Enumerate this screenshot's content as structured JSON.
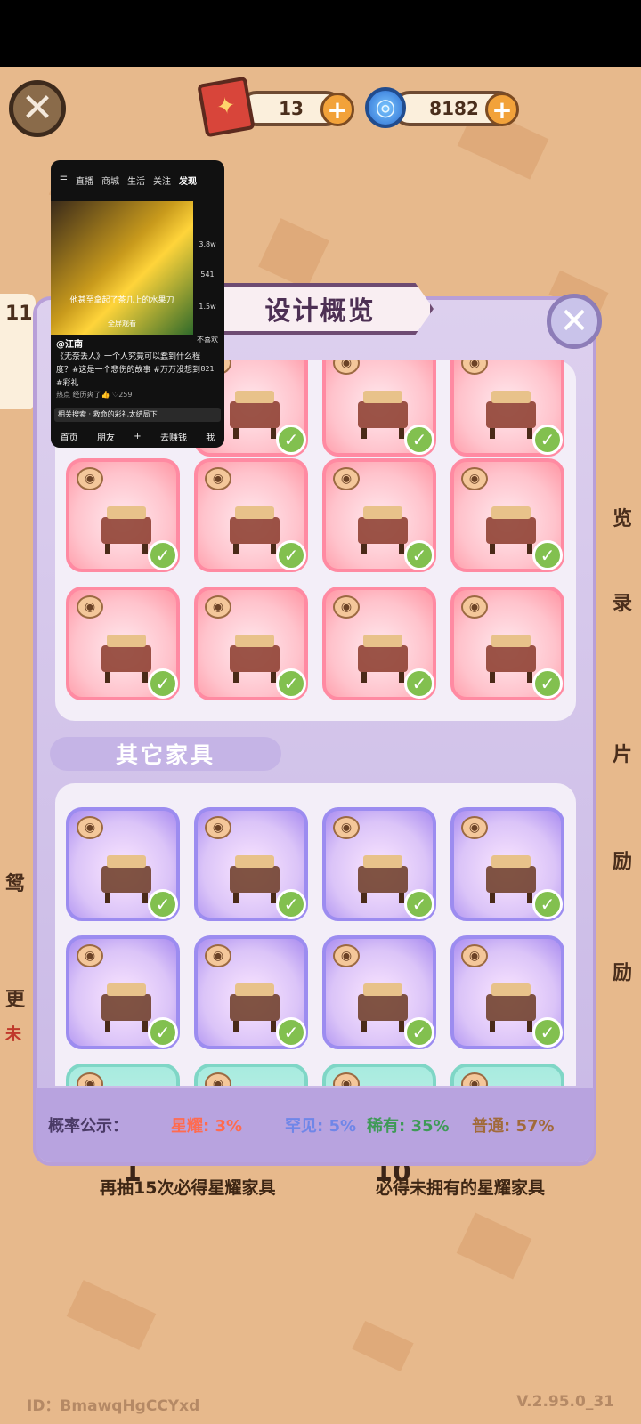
{
  "currency": {
    "tickets": "13",
    "gems": "8182",
    "ticket_glyph": "✦",
    "swirl_glyph": "◎",
    "plus_glyph": "+"
  },
  "close_glyph": "✕",
  "modal": {
    "title": "设计概览",
    "section_other": "其它家具",
    "probability": {
      "label": "概率公示：",
      "star": "星耀: 3%",
      "uncommon": "罕见: 5%",
      "rare": "稀有: 35%",
      "common": "普通: 57%"
    }
  },
  "background": {
    "right_labels": [
      "览",
      "录",
      "片",
      "励",
      "励"
    ],
    "left_labels": [
      "鸳",
      "更",
      "未"
    ],
    "bottom_left": "再抽15次必得星耀家具",
    "bottom_right": "必得未拥有的星耀家具",
    "badge_left": "1",
    "badge_right": "10",
    "id": "ID：BmawqHgCCYxd",
    "version": "V.2.95.0_31",
    "side_number": "11"
  },
  "video": {
    "tabs": [
      "直播",
      "商城",
      "生活",
      "关注",
      "发现"
    ],
    "caption": "他甚至拿起了茶几上的水果刀",
    "fullscreen": "全屏观看",
    "side_counts": [
      "3.8w",
      "541",
      "1.5w",
      "不喜欢",
      "821"
    ],
    "user": "@江南",
    "desc": "《无奈丢人》一个人究竟可以蠢到什么程度？#这是一个悲伤的故事 #万万没想到 #彩礼",
    "meta": "热点  经历爽了👍 ♡259",
    "search": "相关搜索 · 救命的彩礼太结局下",
    "nav": [
      "首页",
      "朋友",
      "+",
      "去赚钱",
      "我"
    ]
  },
  "colors": {
    "star": "#ff8aa2",
    "rare": "#9c8cf0",
    "prob_star": "#ff6b4f",
    "prob_uncommon": "#6f86e8",
    "prob_rare": "#3f9a57",
    "prob_common": "#a16a3a"
  },
  "cards": [
    {
      "name": "plum-tree-card",
      "tier": "star"
    },
    {
      "name": "swing-card",
      "tier": "star"
    },
    {
      "name": "stone-lantern-card",
      "tier": "star"
    },
    {
      "name": "bed-card",
      "tier": "star"
    },
    {
      "name": "long-table-card",
      "tier": "star"
    },
    {
      "name": "plum-window-card",
      "tier": "star"
    },
    {
      "name": "jade-discs-card",
      "tier": "star"
    },
    {
      "name": "railing-card",
      "tier": "star"
    },
    {
      "name": "folding-screen-card",
      "tier": "star"
    },
    {
      "name": "incense-stand-card",
      "tier": "star"
    },
    {
      "name": "bonsai-card",
      "tier": "star"
    },
    {
      "name": "mahjong-table-card",
      "tier": "rare"
    },
    {
      "name": "food-platter-card",
      "tier": "rare"
    },
    {
      "name": "drink-dispenser-card",
      "tier": "rare"
    },
    {
      "name": "tapestry-card",
      "tier": "rare"
    },
    {
      "name": "lamp-stand-card",
      "tier": "rare"
    },
    {
      "name": "decorated-cabinet-card",
      "tier": "rare"
    },
    {
      "name": "bench-card",
      "tier": "rare"
    },
    {
      "name": "lantern-card",
      "tier": "rare"
    },
    {
      "name": "fox-card-1",
      "tier": "teal"
    },
    {
      "name": "fox-card-2",
      "tier": "teal"
    },
    {
      "name": "fox-card-3",
      "tier": "teal"
    },
    {
      "name": "paper-card",
      "tier": "teal"
    }
  ]
}
